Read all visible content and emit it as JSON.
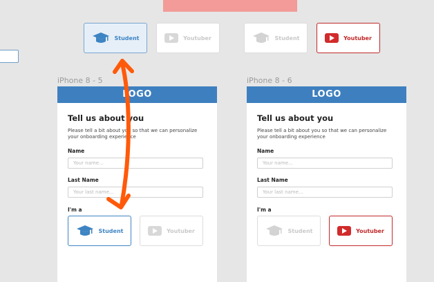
{
  "selector_row": {
    "student_label": "Student",
    "youtuber_label": "Youtuber"
  },
  "frames": [
    {
      "frame_label": "iPhone 8 - 5",
      "logo": "LOGO",
      "heading": "Tell us about you",
      "description": "Please tell a bit about you so that we can personalize your onboarding experience",
      "name_label": "Name",
      "name_placeholder": "Your name...",
      "lastname_label": "Last Name",
      "lastname_placeholder": "Your last name...",
      "role_label": "I'm a",
      "student_label": "Student",
      "youtuber_label": "Youtuber",
      "selected": "student"
    },
    {
      "frame_label": "iPhone 8 - 6",
      "logo": "LOGO",
      "heading": "Tell us about you",
      "description": "Please tell a bit about you so that we can personalize your onboarding experience",
      "name_label": "Name",
      "name_placeholder": "Your name...",
      "lastname_label": "Last Name",
      "lastname_placeholder": "Your last name...",
      "role_label": "I'm a",
      "student_label": "Student",
      "youtuber_label": "Youtuber",
      "selected": "youtuber"
    }
  ],
  "colors": {
    "brand_blue": "#3e80bf",
    "youtube_red": "#d12b2b",
    "annotation_orange": "#ff5a0a",
    "top_bar_pink": "#f29b98"
  },
  "icons": [
    "graduation-cap-icon",
    "youtube-play-icon"
  ]
}
